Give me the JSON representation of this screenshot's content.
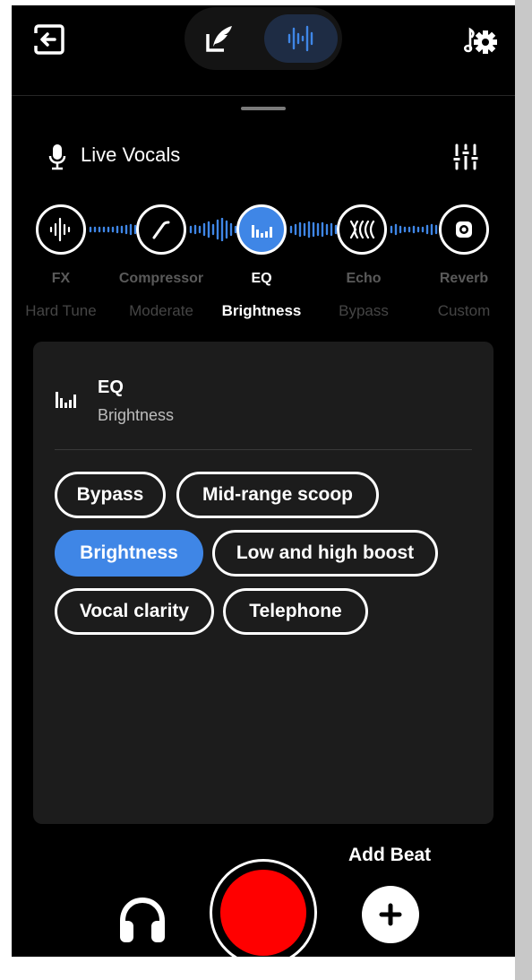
{
  "track": {
    "title": "Live Vocals"
  },
  "effects": [
    {
      "name": "FX",
      "preset": "Hard Tune",
      "icon": "waveform-icon",
      "active": false
    },
    {
      "name": "Compressor",
      "preset": "Moderate",
      "icon": "compressor-curve-icon",
      "active": false
    },
    {
      "name": "EQ",
      "preset": "Brightness",
      "icon": "eq-bars-icon",
      "active": true
    },
    {
      "name": "Echo",
      "preset": "Bypass",
      "icon": "echo-waves-icon",
      "active": false
    },
    {
      "name": "Reverb",
      "preset": "Custom",
      "icon": "speaker-icon",
      "active": false
    }
  ],
  "panel": {
    "title": "EQ",
    "subtitle": "Brightness",
    "presets": [
      {
        "label": "Bypass",
        "selected": false
      },
      {
        "label": "Mid-range scoop",
        "selected": false
      },
      {
        "label": "Brightness",
        "selected": true
      },
      {
        "label": "Low and high boost",
        "selected": false
      },
      {
        "label": "Vocal clarity",
        "selected": false
      },
      {
        "label": "Telephone",
        "selected": false
      }
    ]
  },
  "bottom": {
    "add_beat_label": "Add Beat"
  },
  "colors": {
    "accent": "#3f86e6",
    "record": "#ff0000",
    "background": "#000000",
    "panel": "#1c1c1c"
  }
}
